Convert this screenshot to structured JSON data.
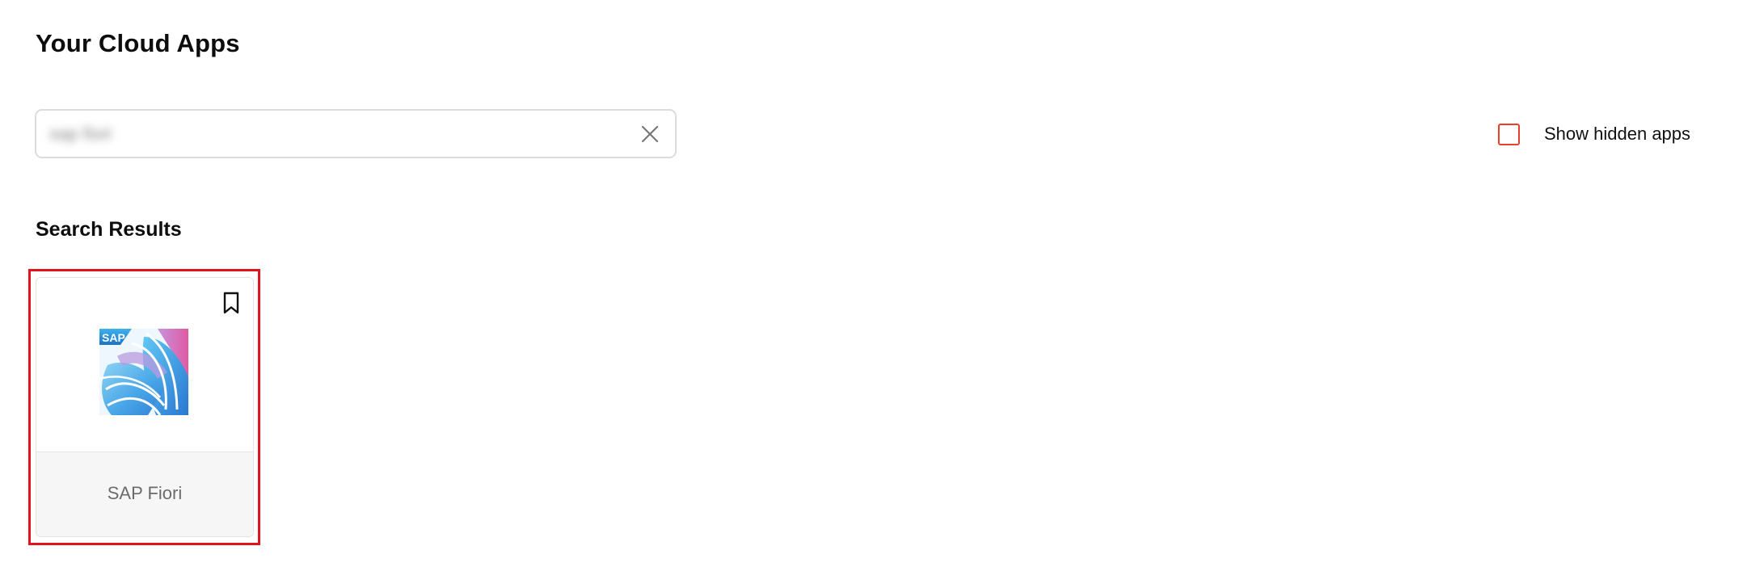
{
  "page": {
    "title": "Your Cloud Apps"
  },
  "search": {
    "value": "sap fiori",
    "placeholder": "",
    "clear_icon": "close-icon"
  },
  "filters": {
    "show_hidden_label": "Show hidden apps",
    "show_hidden_checked": false
  },
  "results": {
    "section_title": "Search Results",
    "apps": [
      {
        "name": "SAP Fiori",
        "logo_text": "SAP",
        "bookmark_icon": "bookmark-icon"
      }
    ]
  },
  "colors": {
    "checkbox_border": "#e8402a",
    "highlight_border": "#e0141e",
    "card_footer_bg": "#f6f6f6",
    "logo_blue": "#2f7fd6",
    "logo_light_blue": "#5cc3f0",
    "logo_pink": "#d5448f"
  }
}
